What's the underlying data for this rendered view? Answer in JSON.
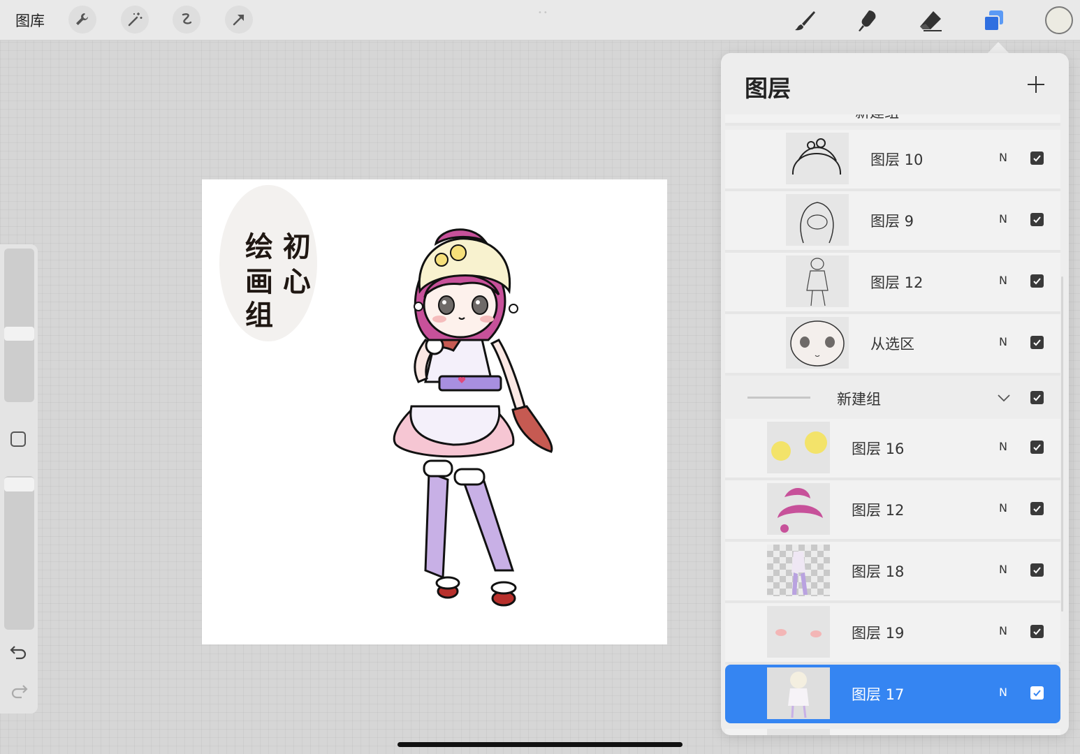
{
  "toolbar": {
    "gallery_label": "图库",
    "left_tools": [
      "wrench-icon",
      "magic-wand-icon",
      "selection-icon",
      "transform-arrow-icon"
    ],
    "right_tools": [
      "brush-icon",
      "smudge-icon",
      "eraser-icon",
      "layers-icon"
    ],
    "active_tool": "layers-icon",
    "current_color": "#ecebe2"
  },
  "canvas_text": {
    "line1": "绘 初",
    "line2": "画 心",
    "line3": "组"
  },
  "layers_panel": {
    "title": "图层",
    "partial_top_label": "新建组",
    "layers": [
      {
        "name": "图层 10",
        "mode": "N",
        "visible": true,
        "indent": "deep"
      },
      {
        "name": "图层 9",
        "mode": "N",
        "visible": true,
        "indent": "deep"
      },
      {
        "name": "图层 12",
        "mode": "N",
        "visible": true,
        "indent": "deep"
      },
      {
        "name": "从选区",
        "mode": "N",
        "visible": true,
        "indent": "deep"
      }
    ],
    "group": {
      "name": "新建组",
      "visible": true
    },
    "group_layers": [
      {
        "name": "图层 16",
        "mode": "N",
        "visible": true
      },
      {
        "name": "图层 12",
        "mode": "N",
        "visible": true
      },
      {
        "name": "图层 18",
        "mode": "N",
        "visible": true
      },
      {
        "name": "图层 19",
        "mode": "N",
        "visible": true
      },
      {
        "name": "图层 17",
        "mode": "N",
        "visible": true,
        "selected": true
      }
    ]
  },
  "colors": {
    "selection_blue": "#3585f2",
    "active_icon_blue": "#2f6fe0"
  }
}
